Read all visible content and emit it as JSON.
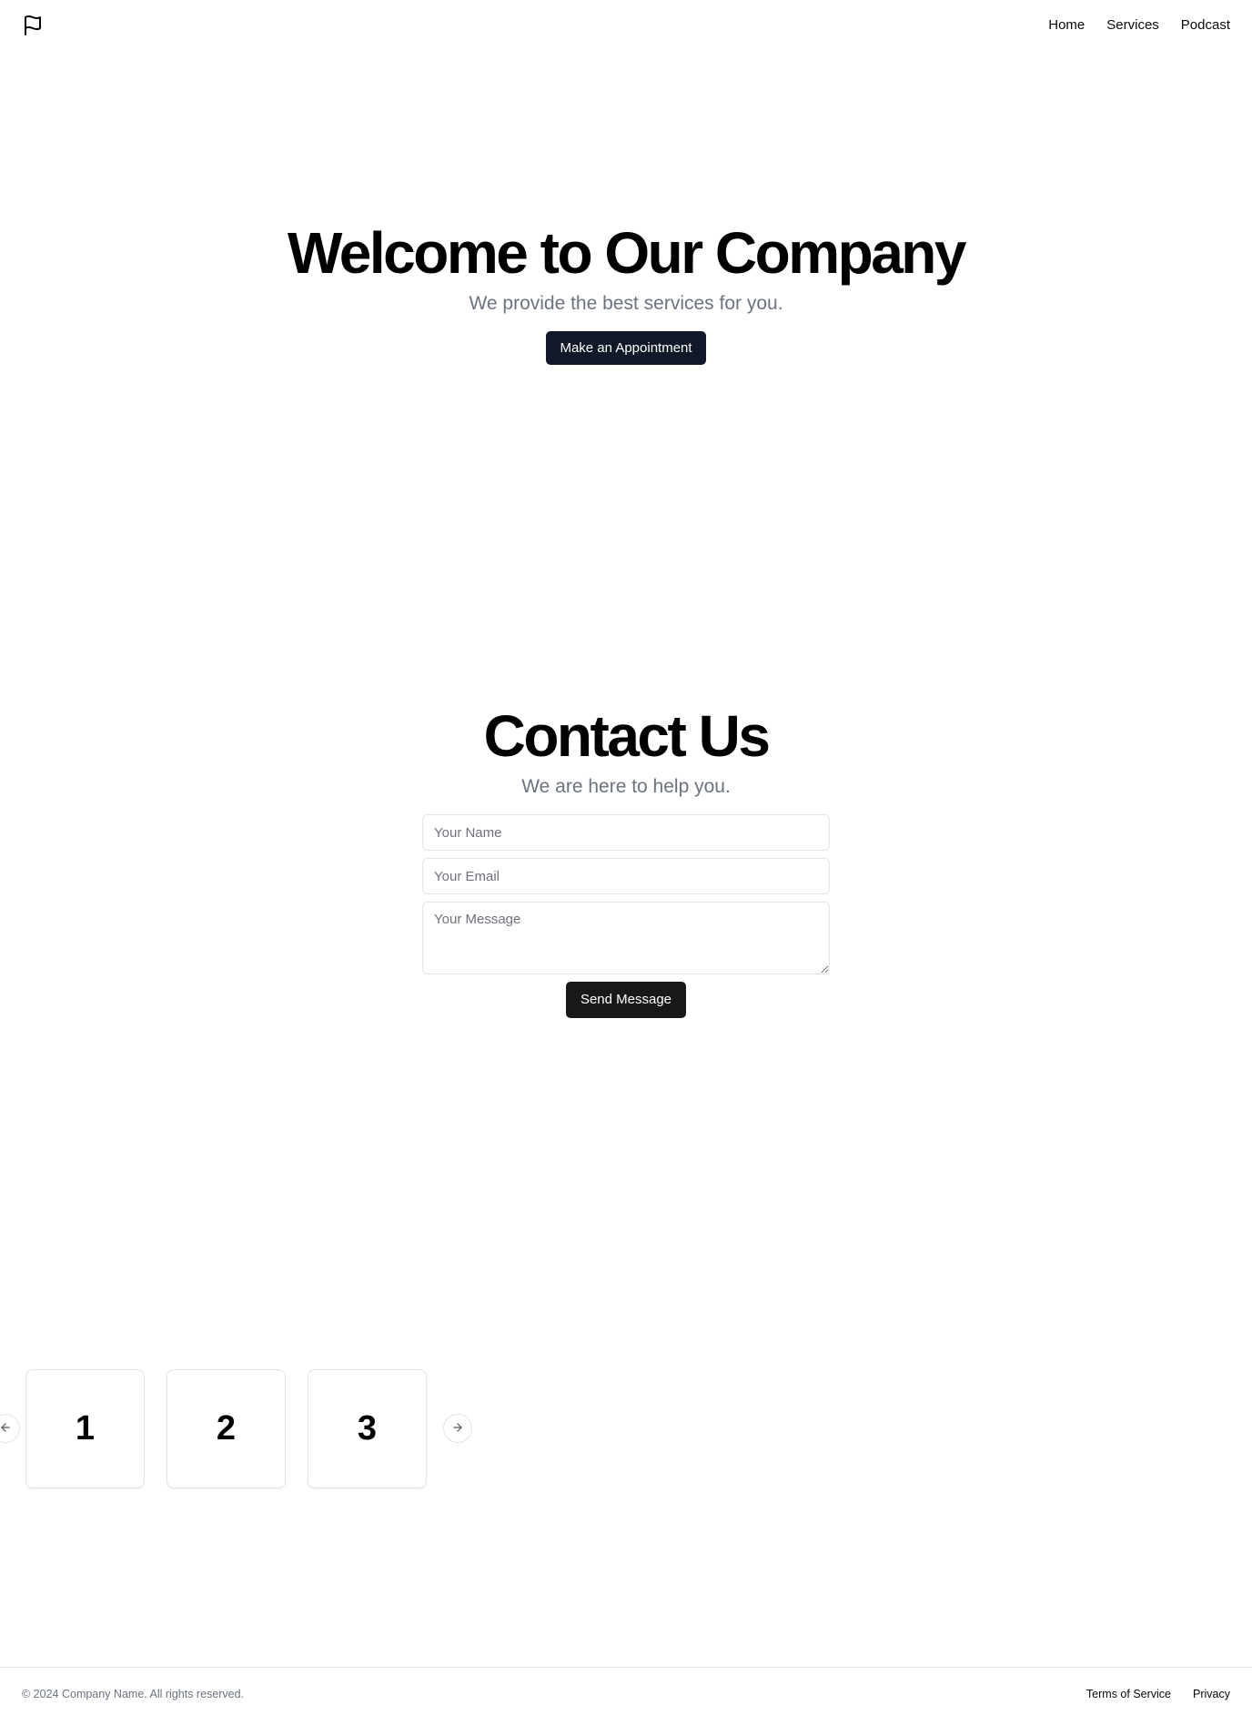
{
  "header": {
    "logo_icon": "flag-icon",
    "nav": [
      {
        "label": "Home"
      },
      {
        "label": "Services"
      },
      {
        "label": "Podcast"
      }
    ]
  },
  "hero": {
    "title": "Welcome to Our Company",
    "subtitle": "We provide the best services for you.",
    "cta_label": "Make an Appointment"
  },
  "contact": {
    "title": "Contact Us",
    "subtitle": "We are here to help you.",
    "name_placeholder": "Your Name",
    "email_placeholder": "Your Email",
    "message_placeholder": "Your Message",
    "submit_label": "Send Message"
  },
  "carousel": {
    "items": [
      "1",
      "2",
      "3"
    ],
    "prev_icon": "arrow-left-icon",
    "next_icon": "arrow-right-icon"
  },
  "footer": {
    "copyright": "© 2024 Company Name. All rights reserved.",
    "links": [
      {
        "label": "Terms of Service"
      },
      {
        "label": "Privacy"
      }
    ]
  },
  "colors": {
    "primary_button": "#111827",
    "submit_button": "#18181b",
    "muted_text": "#6b7280",
    "border": "#e4e4e7"
  }
}
